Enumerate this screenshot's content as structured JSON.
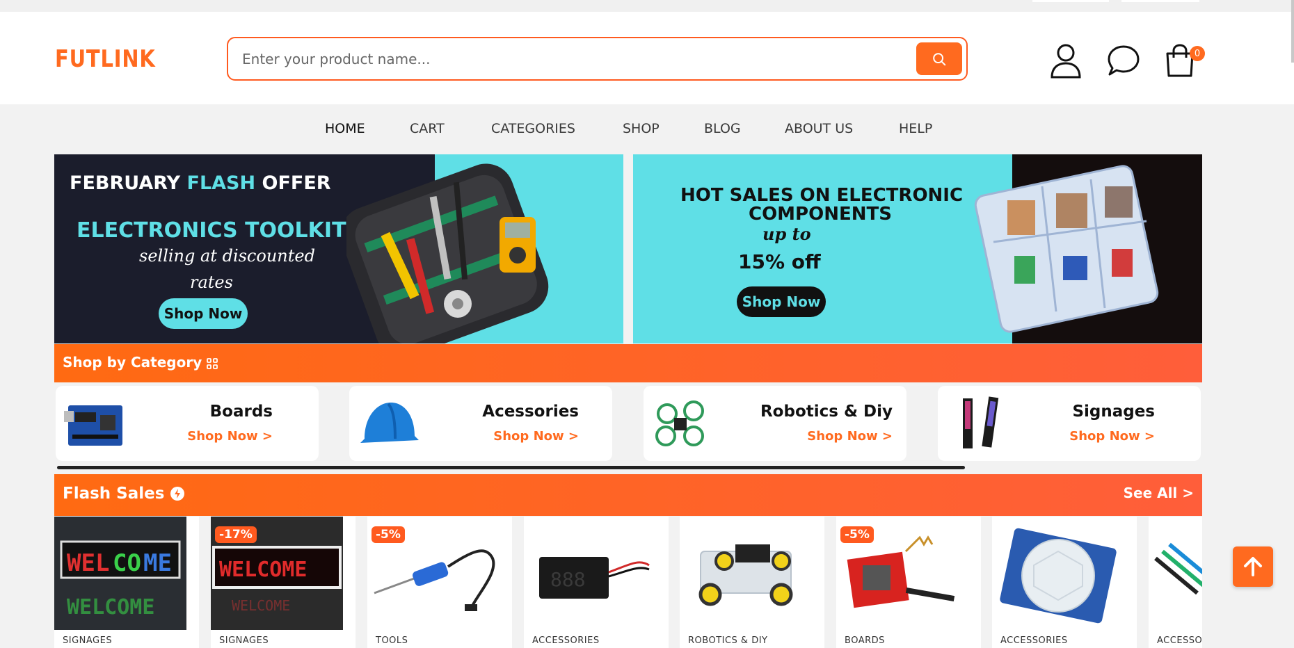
{
  "brand": {
    "logo": "FUTLINK",
    "accent": "#ff6a1f"
  },
  "search": {
    "placeholder": "Enter your product name...",
    "icon": "search-icon"
  },
  "header_icons": {
    "account": "user-icon",
    "chat": "chat-icon",
    "cart": "bag-icon",
    "cart_count": "0"
  },
  "nav": {
    "items": [
      "HOME",
      "CART",
      "CATEGORIES",
      "SHOP",
      "BLOG",
      "ABOUT US",
      "HELP"
    ],
    "active": "HOME"
  },
  "banners": [
    {
      "line1a": "FEBRUARY ",
      "line1b": "FLASH",
      "line1c": " OFFER",
      "headline": "ELECTRONICS TOOLKIT",
      "sub1": "selling at discounted",
      "sub2": "rates",
      "cta": "Shop Now"
    },
    {
      "headline1": "HOT SALES ON ELECTRONIC",
      "headline2": "COMPONENTS",
      "upto": "up to",
      "offer": "15% off",
      "cta": "Shop Now"
    }
  ],
  "categories_section": {
    "title": "Shop by Category",
    "items": [
      {
        "name": "Boards",
        "link": "Shop Now >"
      },
      {
        "name": "Acessories",
        "link": "Shop Now >"
      },
      {
        "name": "Robotics & Diy",
        "link": "Shop Now >"
      },
      {
        "name": "Signages",
        "link": "Shop Now >"
      }
    ]
  },
  "flash_sales": {
    "title": "Flash Sales",
    "see_all": "See All >",
    "products": [
      {
        "category": "SIGNAGES",
        "discount": ""
      },
      {
        "category": "SIGNAGES",
        "discount": "-17%"
      },
      {
        "category": "TOOLS",
        "discount": "-5%"
      },
      {
        "category": "ACCESSORIES",
        "discount": ""
      },
      {
        "category": "ROBOTICS & DIY",
        "discount": ""
      },
      {
        "category": "BOARDS",
        "discount": "-5%"
      },
      {
        "category": "ACCESSORIES",
        "discount": ""
      },
      {
        "category": "ACCESSOR",
        "discount": ""
      }
    ]
  }
}
